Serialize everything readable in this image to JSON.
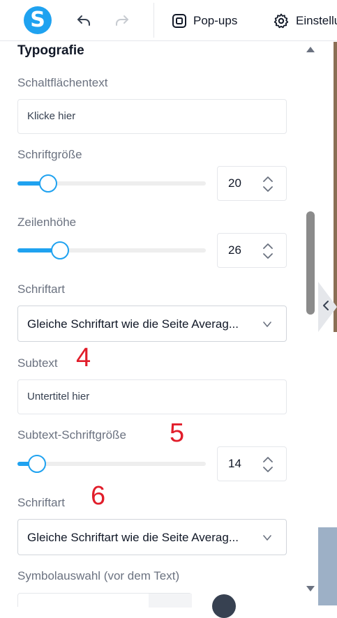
{
  "toolbar": {
    "logo_letter": "S",
    "undo_icon": "undo-icon",
    "redo_icon": "redo-icon",
    "popups_label": "Pop-ups",
    "settings_label": "Einstellu"
  },
  "typography": {
    "section_title": "Typografie",
    "button_text_label": "Schaltflächentext",
    "button_text_value": "Klicke hier",
    "font_size_label": "Schriftgröße",
    "font_size_value": "20",
    "font_size_slider_fraction": 0.16,
    "line_height_label": "Zeilenhöhe",
    "line_height_value": "26",
    "line_height_slider_fraction": 0.22,
    "font_label": "Schriftart",
    "font_value": "Gleiche Schriftart wie die Seite Averag...",
    "subtext_label": "Subtext",
    "subtext_value": "Untertitel hier",
    "subtext_size_label": "Subtext-Schriftgröße",
    "subtext_size_value": "14",
    "subtext_size_slider_fraction": 0.1,
    "subtext_font_label": "Schriftart",
    "subtext_font_value": "Gleiche Schriftart wie die Seite Averag...",
    "symbol_label": "Symbolauswahl (vor dem Text)"
  },
  "annotations": {
    "a4": "4",
    "a5": "5",
    "a6": "6"
  },
  "colors": {
    "accent": "#1fa2f0",
    "annotation": "#e11d2a"
  }
}
